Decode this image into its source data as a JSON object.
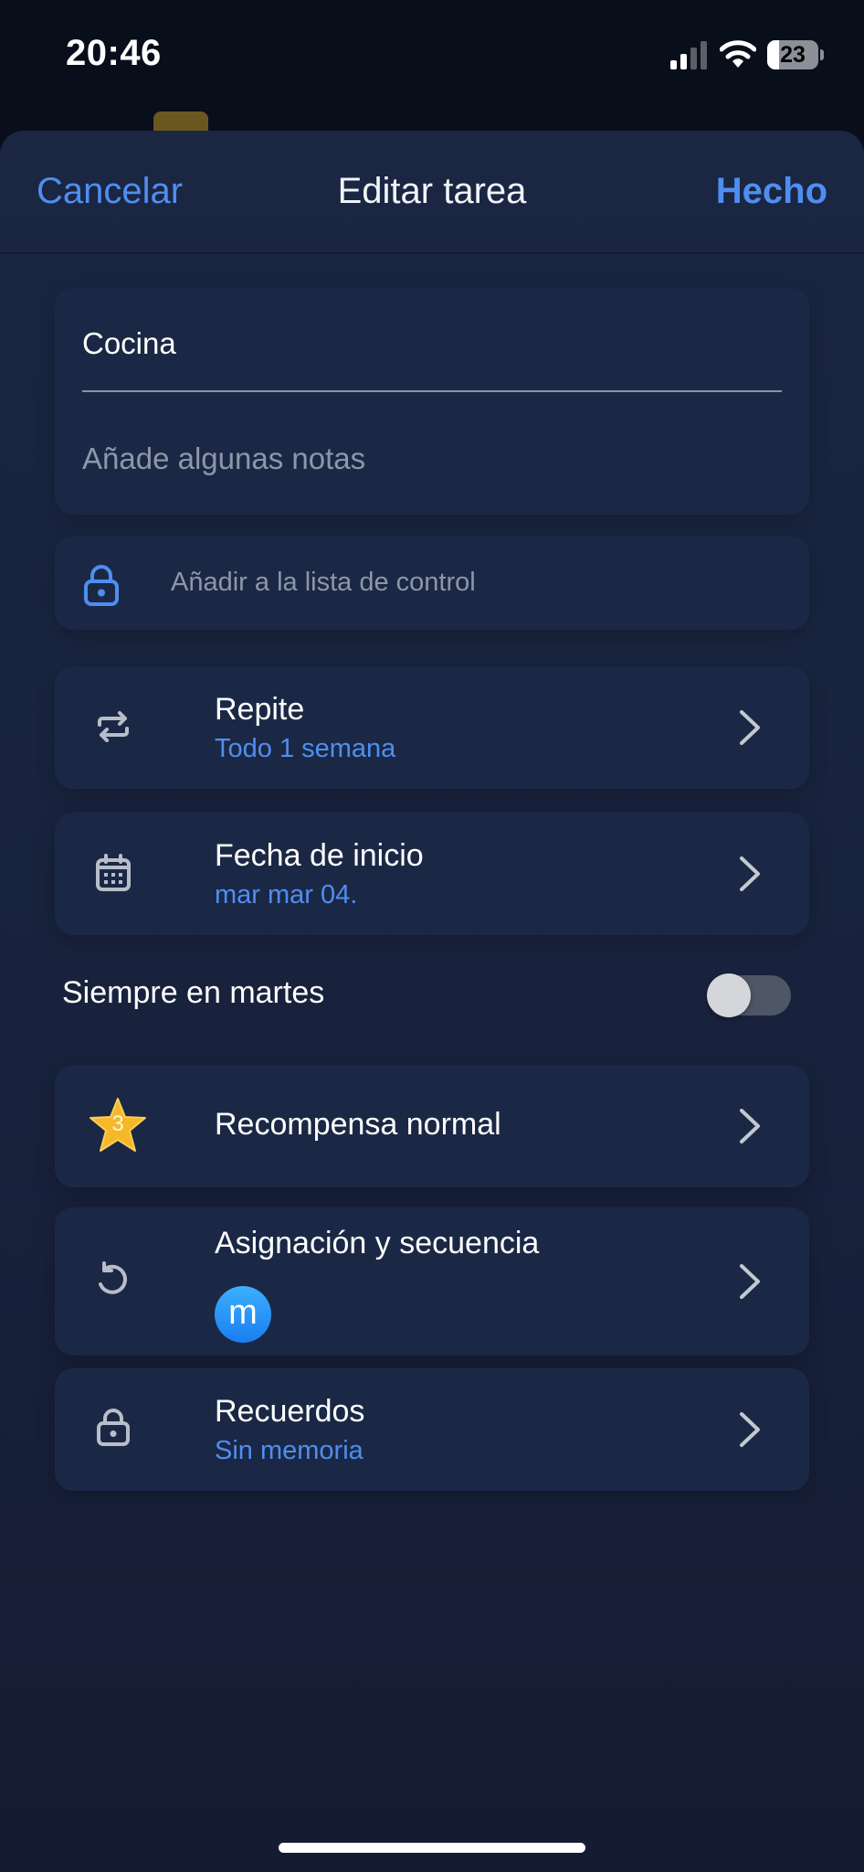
{
  "status_bar": {
    "time": "20:46",
    "battery_level": "23",
    "battery_fraction": 0.23
  },
  "nav": {
    "cancel_label": "Cancelar",
    "title": "Editar tarea",
    "done_label": "Hecho"
  },
  "task": {
    "title": "Cocina",
    "notes_placeholder": "Añade algunas notas"
  },
  "checklist": {
    "label": "Añadir a la lista de control",
    "icon": "lock-icon"
  },
  "repeat": {
    "title": "Repite",
    "value": "Todo 1 semana",
    "icon": "repeat-icon"
  },
  "start_date": {
    "title": "Fecha de inicio",
    "value": "mar mar 04.",
    "icon": "calendar-icon"
  },
  "always_on": {
    "label": "Siempre en martes",
    "enabled": false
  },
  "reward": {
    "title": "Recompensa normal",
    "stars": "3",
    "icon": "star-icon"
  },
  "assignment": {
    "title": "Asignación y secuencia",
    "avatar_initial": "m",
    "icon": "rotate-icon"
  },
  "memory": {
    "title": "Recuerdos",
    "value": "Sin memoria",
    "icon": "lock-icon"
  },
  "colors": {
    "accent": "#4f8ef0",
    "sheet_background": "#1a2642",
    "card_background": "#1b2845",
    "star": "#f5b82a",
    "avatar": "#1f8cf5"
  }
}
